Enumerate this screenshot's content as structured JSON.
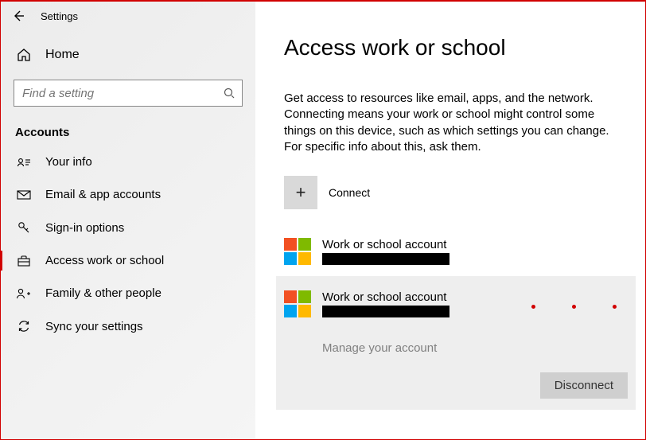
{
  "titlebar": {
    "title": "Settings"
  },
  "home_label": "Home",
  "search": {
    "placeholder": "Find a setting"
  },
  "sidebar": {
    "section_header": "Accounts",
    "items": [
      {
        "label": "Your info"
      },
      {
        "label": "Email & app accounts"
      },
      {
        "label": "Sign-in options"
      },
      {
        "label": "Access work or school"
      },
      {
        "label": "Family & other people"
      },
      {
        "label": "Sync your settings"
      }
    ]
  },
  "main": {
    "heading": "Access work or school",
    "description": "Get access to resources like email, apps, and the network. Connecting means your work or school might control some things on this device, such as which settings you can change. For specific info about this, ask them.",
    "connect_label": "Connect",
    "accounts": [
      {
        "title": "Work or school account"
      },
      {
        "title": "Work or school account"
      }
    ],
    "manage_label": "Manage your account",
    "disconnect_label": "Disconnect"
  }
}
